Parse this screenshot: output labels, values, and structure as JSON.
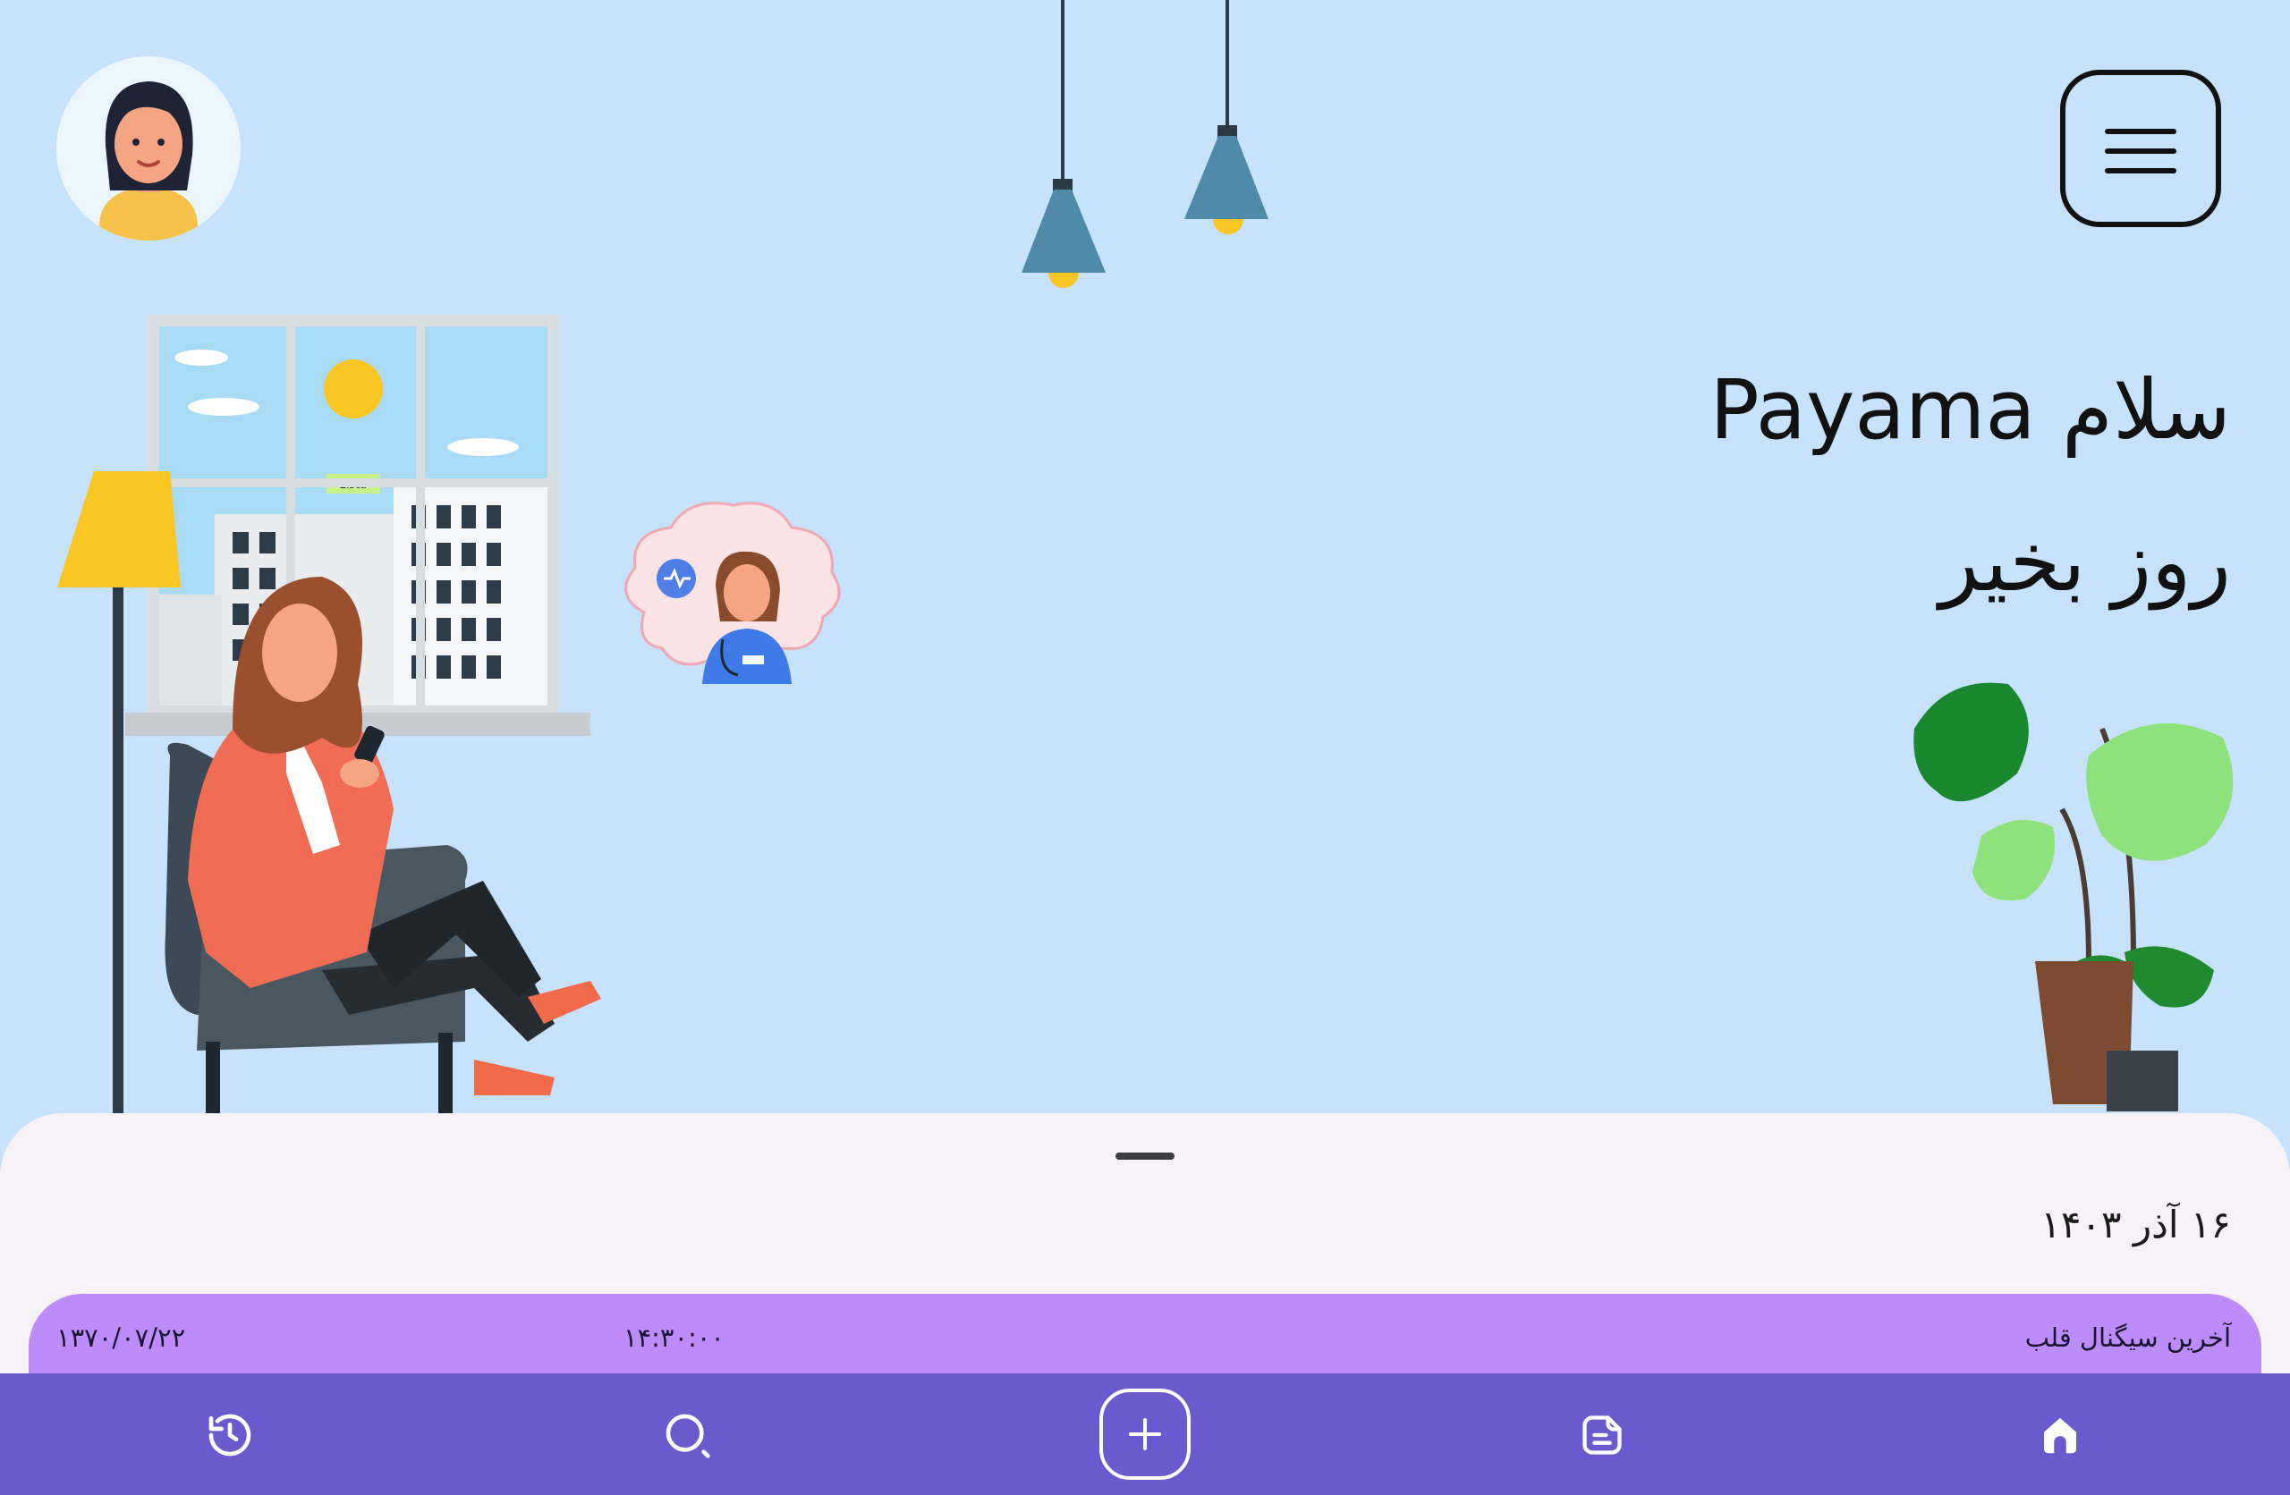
{
  "header": {
    "avatar_icon": "user-avatar",
    "menu_icon": "hamburger-menu-icon"
  },
  "greeting": {
    "line1": "سلام Payama",
    "line2": "روز بخیر"
  },
  "illustration": {
    "window_sign": "zista"
  },
  "sheet": {
    "date": "۱۶ آذر ۱۴۰۳",
    "last_signal": {
      "label": "آخرین سیگنال قلب",
      "time": "۱۴:۳۰:۰۰",
      "date": "۱۳۷۰/۰۷/۲۲"
    }
  },
  "nav": {
    "items": [
      {
        "name": "history",
        "icon": "history-icon"
      },
      {
        "name": "search",
        "icon": "search-icon"
      },
      {
        "name": "add",
        "icon": "plus-icon"
      },
      {
        "name": "documents",
        "icon": "document-icon"
      },
      {
        "name": "home",
        "icon": "home-icon",
        "active": true
      }
    ]
  },
  "colors": {
    "background": "#c6e2fd",
    "sheet": "#f6f2f8",
    "card": "#bd8cfb",
    "nav": "#6a5acd"
  }
}
